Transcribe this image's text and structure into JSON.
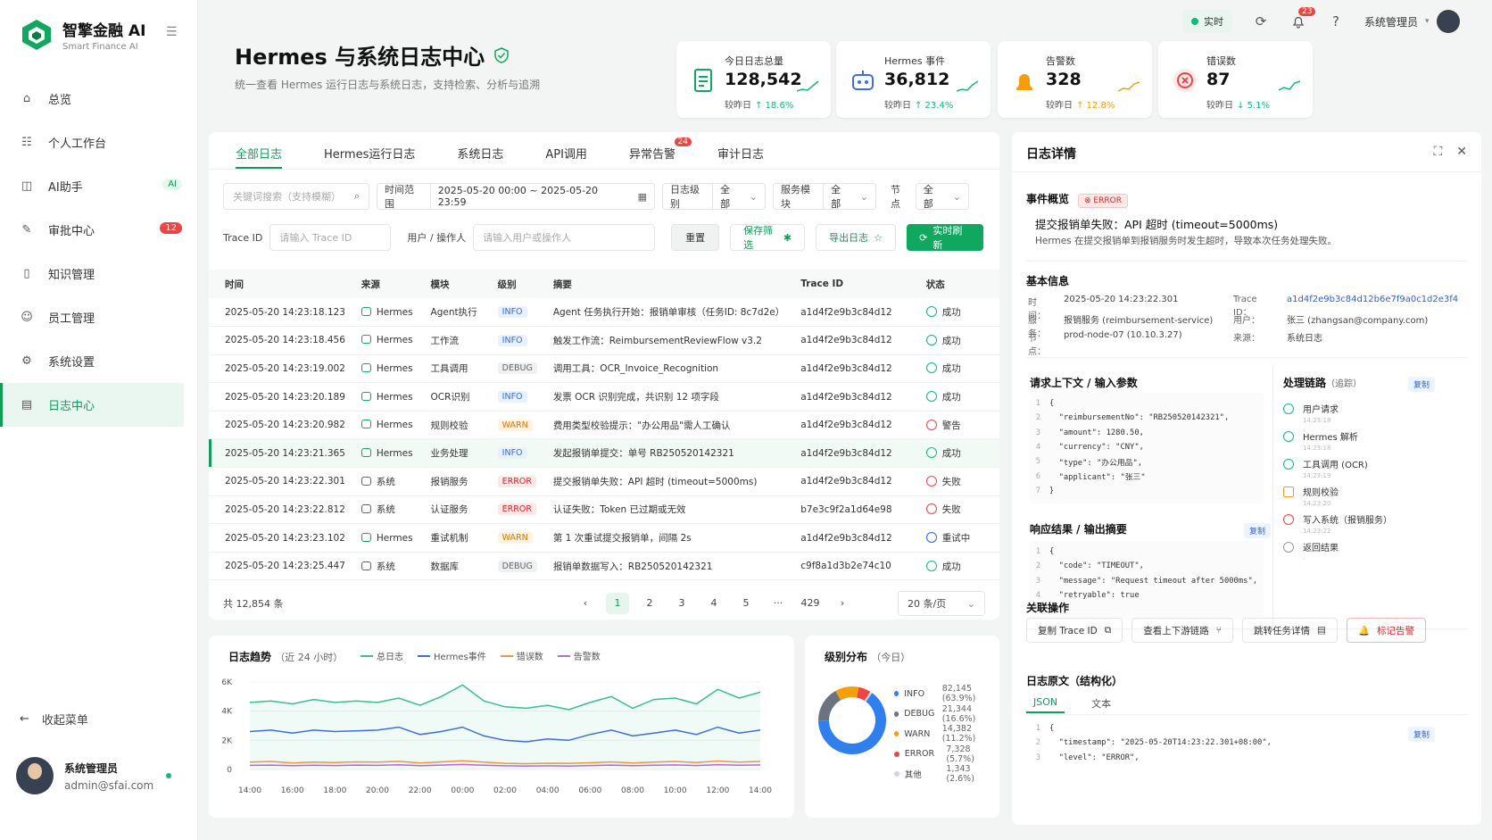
{
  "brand": {
    "title": "智擎金融 AI",
    "subtitle": "Smart Finance AI"
  },
  "nav": [
    {
      "label": "总览",
      "icon": "home-icon"
    },
    {
      "label": "个人工作台",
      "icon": "users-icon"
    },
    {
      "label": "AI助手",
      "icon": "ai-icon",
      "badge": "AI"
    },
    {
      "label": "审批中心",
      "icon": "edit-icon",
      "badge": "12"
    },
    {
      "label": "知识管理",
      "icon": "book-icon"
    },
    {
      "label": "员工管理",
      "icon": "person-icon"
    },
    {
      "label": "系统设置",
      "icon": "gear-icon"
    },
    {
      "label": "日志中心",
      "icon": "log-icon",
      "active": true
    }
  ],
  "collapse_label": "收起菜单",
  "user": {
    "name": "系统管理员",
    "email": "admin@sfai.com"
  },
  "topbar": {
    "live": "实时",
    "notify_count": "23",
    "admin": "系统管理员"
  },
  "page": {
    "title": "Hermes 与系统日志中心",
    "subtitle": "统一查看 Hermes 运行日志与系统日志，支持检索、分析与追溯"
  },
  "stats": [
    {
      "label": "今日日志总量",
      "value": "128,542",
      "cmp_label": "较昨日",
      "cmp": "↑ 18.6%",
      "color": "#10b981"
    },
    {
      "label": "Hermes 事件",
      "value": "36,812",
      "cmp_label": "较昨日",
      "cmp": "↑ 23.4%",
      "color": "#10b981"
    },
    {
      "label": "告警数",
      "value": "328",
      "cmp_label": "较昨日",
      "cmp": "↑ 12.8%",
      "color": "#f59e0b"
    },
    {
      "label": "错误数",
      "value": "87",
      "cmp_label": "较昨日",
      "cmp": "↓ 5.1%",
      "color": "#10b981"
    }
  ],
  "tabs": [
    {
      "label": "全部日志",
      "active": true
    },
    {
      "label": "Hermes运行日志"
    },
    {
      "label": "系统日志"
    },
    {
      "label": "API调用"
    },
    {
      "label": "异常告警",
      "badge": "24"
    },
    {
      "label": "审计日志"
    }
  ],
  "filters": {
    "keyword_placeholder": "关键词搜索（支持模糊）",
    "time_label": "时间范围",
    "time_value": "2025-05-20 00:00 ~ 2025-05-20 23:59",
    "level_label": "日志级别",
    "level_value": "全部",
    "module_label": "服务模块",
    "module_value": "全部",
    "node_label": "节点",
    "node_value": "全部",
    "trace_label": "Trace ID",
    "trace_placeholder": "请输入 Trace ID",
    "user_label": "用户 / 操作人",
    "user_placeholder": "请输入用户或操作人",
    "reset": "重置",
    "save": "保存筛选",
    "export": "导出日志",
    "refresh": "实时刷新"
  },
  "table": {
    "headers": [
      "时间",
      "来源",
      "模块",
      "级别",
      "摘要",
      "Trace ID",
      "状态"
    ],
    "rows": [
      {
        "time": "2025-05-20 14:23:18.123",
        "source": "Hermes",
        "module": "Agent执行",
        "level": "INFO",
        "summary": "Agent 任务执行开始：报销单审核（任务ID: 8c7d2e）",
        "trace": "a1d4f2e9b3c84d12",
        "status": "成功",
        "st": "ok"
      },
      {
        "time": "2025-05-20 14:23:18.456",
        "source": "Hermes",
        "module": "工作流",
        "level": "INFO",
        "summary": "触发工作流：ReimbursementReviewFlow v3.2",
        "trace": "a1d4f2e9b3c84d12",
        "status": "成功",
        "st": "ok"
      },
      {
        "time": "2025-05-20 14:23:19.002",
        "source": "Hermes",
        "module": "工具调用",
        "level": "DEBUG",
        "summary": "调用工具：OCR_Invoice_Recognition",
        "trace": "a1d4f2e9b3c84d12",
        "status": "成功",
        "st": "ok"
      },
      {
        "time": "2025-05-20 14:23:20.189",
        "source": "Hermes",
        "module": "OCR识别",
        "level": "INFO",
        "summary": "发票 OCR 识别完成，共识别 12 项字段",
        "trace": "a1d4f2e9b3c84d12",
        "status": "成功",
        "st": "ok"
      },
      {
        "time": "2025-05-20 14:23:20.982",
        "source": "Hermes",
        "module": "规则校验",
        "level": "WARN",
        "summary": "费用类型校验提示：\"办公用品\"需人工确认",
        "trace": "a1d4f2e9b3c84d12",
        "status": "警告",
        "st": "warn"
      },
      {
        "time": "2025-05-20 14:23:21.365",
        "source": "Hermes",
        "module": "业务处理",
        "level": "INFO",
        "summary": "发起报销单提交：单号 RB250520142321",
        "trace": "a1d4f2e9b3c84d12",
        "status": "成功",
        "st": "ok",
        "selected": true
      },
      {
        "time": "2025-05-20 14:23:22.301",
        "source": "系统",
        "module": "报销服务",
        "level": "ERROR",
        "summary": "提交报销单失败：API 超时 (timeout=5000ms)",
        "trace": "a1d4f2e9b3c84d12",
        "status": "失败",
        "st": "fail"
      },
      {
        "time": "2025-05-20 14:23:22.812",
        "source": "系统",
        "module": "认证服务",
        "level": "ERROR",
        "summary": "认证失败：Token 已过期或无效",
        "trace": "b7e3c9f2a1d64e98",
        "status": "失败",
        "st": "fail"
      },
      {
        "time": "2025-05-20 14:23:23.102",
        "source": "Hermes",
        "module": "重试机制",
        "level": "WARN",
        "summary": "第 1 次重试提交报销单，间隔 2s",
        "trace": "a1d4f2e9b3c84d12",
        "status": "重试中",
        "st": "retry"
      },
      {
        "time": "2025-05-20 14:23:25.447",
        "source": "系统",
        "module": "数据库",
        "level": "DEBUG",
        "summary": "报销单数据写入：RB250520142321",
        "trace": "c9f8a1d3b2e74c10",
        "status": "成功",
        "st": "ok"
      }
    ]
  },
  "pager": {
    "total": "共 12,854 条",
    "pages": [
      "1",
      "2",
      "3",
      "4",
      "5",
      "···",
      "429"
    ],
    "size": "20 条/页"
  },
  "trend": {
    "title": "日志趋势",
    "subtitle": "（近 24 小时）"
  },
  "dist": {
    "title": "级别分布",
    "subtitle": "（今日）",
    "items": [
      {
        "name": "INFO",
        "value": "82,145 (63.9%)",
        "color": "#2f80ed"
      },
      {
        "name": "DEBUG",
        "value": "21,344 (16.6%)",
        "color": "#6b7280"
      },
      {
        "name": "WARN",
        "value": "14,382 (11.2%)",
        "color": "#f59e0b"
      },
      {
        "name": "ERROR",
        "value": "7,328 (5.7%)",
        "color": "#ef4444"
      },
      {
        "name": "其他",
        "value": "1,343 (2.6%)",
        "color": "#d1d5db"
      }
    ]
  },
  "chart_data": [
    {
      "type": "line",
      "title": "日志趋势",
      "x": [
        "14:00",
        "15:00",
        "16:00",
        "17:00",
        "18:00",
        "19:00",
        "20:00",
        "21:00",
        "22:00",
        "23:00",
        "00:00",
        "01:00",
        "02:00",
        "03:00",
        "04:00",
        "05:00",
        "06:00",
        "07:00",
        "08:00",
        "09:00",
        "10:00",
        "11:00",
        "12:00",
        "13:00",
        "14:00"
      ],
      "xticks": [
        "14:00",
        "16:00",
        "18:00",
        "20:00",
        "22:00",
        "00:00",
        "02:00",
        "04:00",
        "06:00",
        "08:00",
        "10:00",
        "12:00",
        "14:00"
      ],
      "yticks": [
        "0",
        "2K",
        "4K",
        "6K"
      ],
      "ylim": [
        0,
        6000
      ],
      "series": [
        {
          "name": "总日志",
          "color": "#3bbf8c",
          "values": [
            4600,
            4700,
            4500,
            4800,
            4600,
            4700,
            4600,
            4900,
            4400,
            5000,
            5800,
            4700,
            4300,
            4200,
            4400,
            4100,
            4600,
            5000,
            4200,
            4800,
            4900,
            4500,
            5500,
            4900,
            5300
          ]
        },
        {
          "name": "Hermes事件",
          "color": "#3b6fe0",
          "values": [
            2600,
            2700,
            2500,
            2700,
            2600,
            2650,
            2700,
            2900,
            2400,
            2600,
            2900,
            2300,
            2000,
            1900,
            2100,
            2000,
            2400,
            2700,
            2300,
            2500,
            2700,
            2400,
            2900,
            2500,
            2700
          ]
        },
        {
          "name": "错误数",
          "color": "#f0953a",
          "values": [
            500,
            550,
            450,
            500,
            480,
            520,
            500,
            560,
            450,
            520,
            600,
            500,
            420,
            400,
            430,
            420,
            460,
            520,
            450,
            500,
            550,
            470,
            580,
            500,
            550
          ]
        },
        {
          "name": "告警数",
          "color": "#b468d8",
          "values": [
            280,
            300,
            260,
            290,
            270,
            300,
            280,
            320,
            260,
            300,
            340,
            290,
            250,
            240,
            250,
            240,
            270,
            300,
            260,
            290,
            310,
            270,
            330,
            290,
            310
          ]
        }
      ]
    },
    {
      "type": "pie",
      "title": "级别分布",
      "categories": [
        "INFO",
        "DEBUG",
        "WARN",
        "ERROR",
        "其他"
      ],
      "values": [
        82145,
        21344,
        14382,
        7328,
        1343
      ],
      "colors": [
        "#2f80ed",
        "#6b7280",
        "#f59e0b",
        "#ef4444",
        "#d1d5db"
      ]
    }
  ],
  "detail": {
    "title": "日志详情",
    "overview_title": "事件概览",
    "overview_tag": "ERROR",
    "event_title": "提交报销单失败：API 超时 (timeout=5000ms)",
    "event_desc": "Hermes 在提交报销单到报销服务时发生超时，导致本次任务处理失败。",
    "basic_title": "基本信息",
    "basic_left": [
      {
        "k": "时间：",
        "v": "2025-05-20 14:23:22.301"
      },
      {
        "k": "服务：",
        "v": "报销服务 (reimbursement-service)"
      },
      {
        "k": "节点：",
        "v": "prod-node-07 (10.10.3.27)"
      }
    ],
    "basic_right": [
      {
        "k": "Trace ID：",
        "v": "a1d4f2e9b3c84d12b6e7f9a0c1d2e3f4"
      },
      {
        "k": "用户：",
        "v": "张三 (zhangsan@company.com)"
      },
      {
        "k": "来源：",
        "v": "系统日志"
      }
    ],
    "req_title": "请求上下文 / 输入参数",
    "req_lines": [
      "{",
      "  \"reimbursementNo\": \"RB250520142321\",",
      "  \"amount\": 1280.50,",
      "  \"currency\": \"CNY\",",
      "  \"type\": \"办公用品\",",
      "  \"applicant\": \"张三\"",
      "}"
    ],
    "resp_title": "响应结果 / 输出摘要",
    "resp_lines": [
      "{",
      "  \"code\": \"TIMEOUT\",",
      "  \"message\": \"Request timeout after 5000ms\",",
      "  \"retryable\": true",
      "}"
    ],
    "copy": "复制",
    "chain_title": "处理链路",
    "chain_sub": "（追踪）",
    "chain": [
      {
        "label": "用户请求",
        "time": "14:23:18",
        "kind": "ok"
      },
      {
        "label": "Hermes 解析",
        "time": "14:23:18",
        "kind": "ok"
      },
      {
        "label": "工具调用 (OCR)",
        "time": "14:23:19",
        "kind": "ok"
      },
      {
        "label": "规则校验",
        "time": "14:23:20",
        "kind": "warn"
      },
      {
        "label": "写入系统（报销服务）",
        "time": "14:23:22",
        "kind": "err"
      },
      {
        "label": "返回结果",
        "time": "-",
        "kind": "gray"
      }
    ],
    "ops_title": "关联操作",
    "ops": [
      {
        "label": "复制 Trace ID",
        "icon": "copy-icon"
      },
      {
        "label": "查看上下游链路",
        "icon": "branch-icon"
      },
      {
        "label": "跳转任务详情",
        "icon": "doc-icon"
      },
      {
        "label": "标记告警",
        "icon": "bell-icon",
        "red": true
      }
    ],
    "raw_title": "日志原文（结构化）",
    "raw_tabs": [
      "JSON",
      "文本"
    ],
    "raw_lines": [
      "{",
      "  \"timestamp\": \"2025-05-20T14:23:22.301+08:00\",",
      "  \"level\": \"ERROR\","
    ]
  }
}
